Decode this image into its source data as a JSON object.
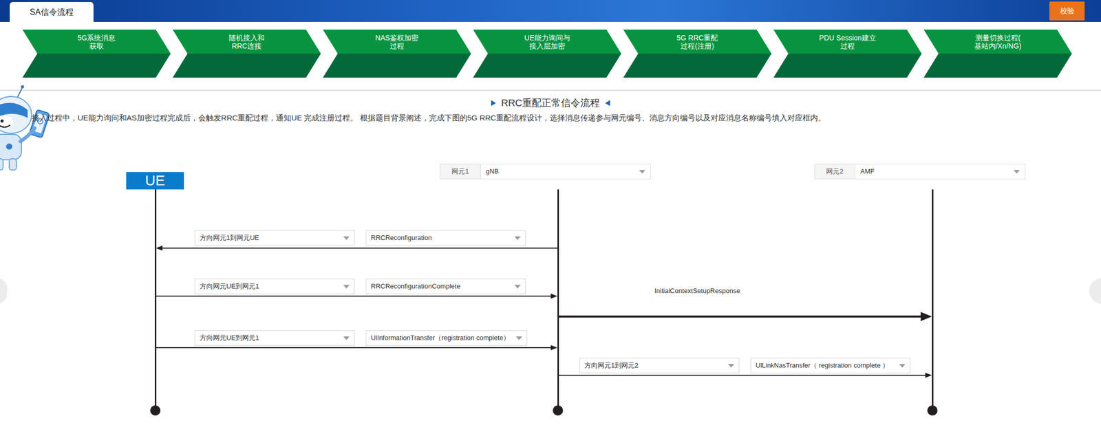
{
  "header": {
    "tab": {
      "label": "SA信令流程",
      "selected": true
    },
    "check_button": "校验"
  },
  "steps": [
    {
      "lines": [
        "5G系统消息",
        "获取"
      ]
    },
    {
      "lines": [
        "随机接入和",
        "RRC连接"
      ]
    },
    {
      "lines": [
        "NAS鉴权加密",
        "过程"
      ]
    },
    {
      "lines": [
        "UE能力询问与",
        "接入层加密"
      ]
    },
    {
      "lines": [
        "5G RRC重配",
        "过程(注册)"
      ]
    },
    {
      "lines": [
        "PDU Session建立",
        "过程"
      ]
    },
    {
      "lines": [
        "测量切换过程(",
        "基站内/Xn/NG)"
      ]
    }
  ],
  "section": {
    "left_mark": "▶",
    "title": "RRC重配正常信令流程",
    "right_mark": "◀",
    "description": "接入过程中，UE能力询问和AS加密过程完成后，会触发RRC重配过程，通知UE 完成注册过程。 根据题目背景阐述，完成下图的5G RRC重配流程设计，选择消息传递参与网元编号、消息方向编号以及对应消息名称编号填入对应框内。"
  },
  "diagram": {
    "ue": {
      "label": "UE"
    },
    "nodes": [
      {
        "tag": "网元1",
        "value": "gNB"
      },
      {
        "tag": "网元2",
        "value": "AMF"
      }
    ],
    "messages": [
      {
        "kind": "dropdown",
        "direction": "方向网元1到网元UE",
        "name": "RRCReconfiguration",
        "from": 1,
        "to": 0
      },
      {
        "kind": "dropdown",
        "direction": "方向网元UE到网元1",
        "name": "RRCReconfigurationComplete",
        "from": 0,
        "to": 1
      },
      {
        "kind": "label",
        "name": "InitialContextSetupResponse",
        "from": 1,
        "to": 2
      },
      {
        "kind": "dropdown",
        "direction": "方向网元UE到网元1",
        "name": "UlInformationTransfer（registration complete）",
        "from": 0,
        "to": 1
      },
      {
        "kind": "dropdown",
        "direction": "方向网元1到网元2",
        "name": "UlLinkNasTransfer（ registration complete ）",
        "from": 1,
        "to": 2
      }
    ]
  }
}
